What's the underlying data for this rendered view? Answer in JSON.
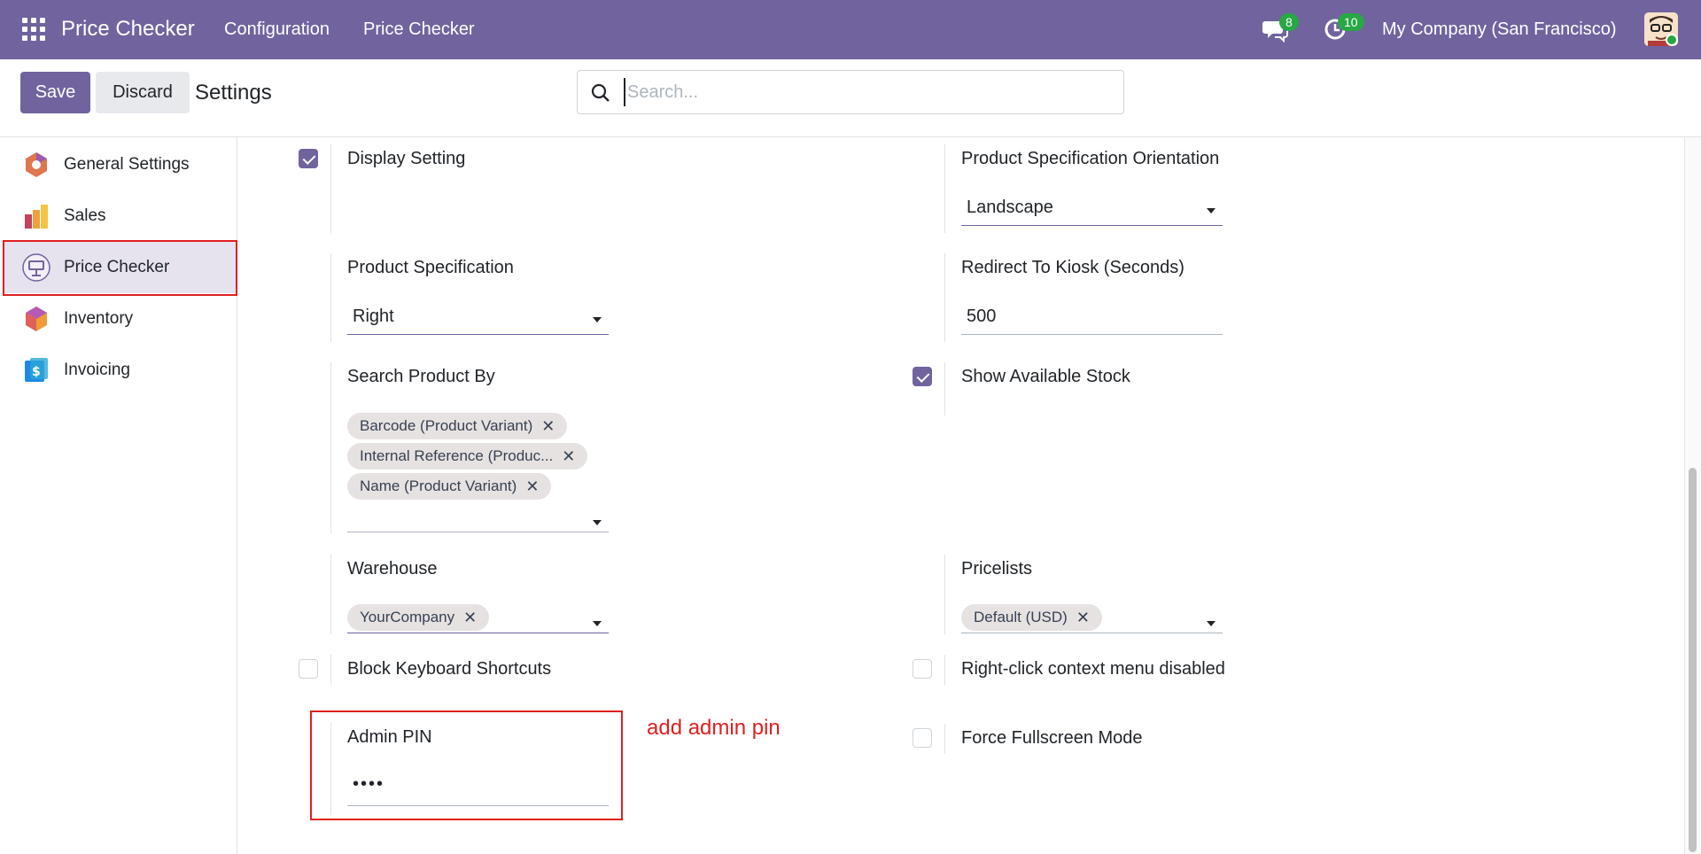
{
  "navbar": {
    "brand": "Price Checker",
    "menu": [
      "Configuration",
      "Price Checker"
    ],
    "chat_count": "8",
    "activity_count": "10",
    "company": "My Company (San Francisco)",
    "color": "#71639e"
  },
  "control_panel": {
    "save_label": "Save",
    "discard_label": "Discard",
    "title": "Settings",
    "search_placeholder": "Search..."
  },
  "sidebar": {
    "items": [
      {
        "label": "General Settings",
        "icon": "general-settings-icon"
      },
      {
        "label": "Sales",
        "icon": "sales-icon"
      },
      {
        "label": "Price Checker",
        "icon": "price-checker-icon",
        "active": true
      },
      {
        "label": "Inventory",
        "icon": "inventory-icon"
      },
      {
        "label": "Invoicing",
        "icon": "invoicing-icon"
      }
    ]
  },
  "settings": {
    "display_setting": {
      "label": "Display Setting",
      "checked": true
    },
    "orientation": {
      "label": "Product Specification Orientation",
      "value": "Landscape"
    },
    "product_spec": {
      "label": "Product Specification",
      "value": "Right"
    },
    "redirect": {
      "label": "Redirect To Kiosk (Seconds)",
      "value": "500"
    },
    "search_by": {
      "label": "Search Product By",
      "tags": [
        "Barcode (Product Variant)",
        "Internal Reference (Produc...",
        "Name (Product Variant)"
      ]
    },
    "show_stock": {
      "label": "Show Available Stock",
      "checked": true
    },
    "warehouse": {
      "label": "Warehouse",
      "tags": [
        "YourCompany"
      ]
    },
    "pricelists": {
      "label": "Pricelists",
      "tags": [
        "Default (USD)"
      ]
    },
    "block_shortcuts": {
      "label": "Block Keyboard Shortcuts",
      "checked": false
    },
    "right_click": {
      "label": "Right-click context menu disabled",
      "checked": false
    },
    "admin_pin": {
      "label": "Admin PIN",
      "value": "••••"
    },
    "fullscreen": {
      "label": "Force Fullscreen Mode",
      "checked": false
    }
  },
  "annotation": "add admin pin",
  "tag_remove_glyph": "✕"
}
